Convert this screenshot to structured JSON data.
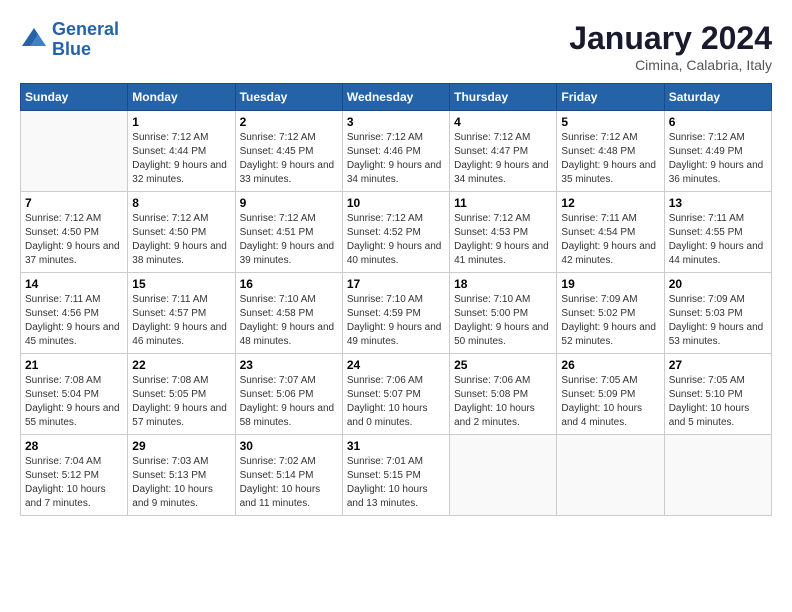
{
  "header": {
    "logo_line1": "General",
    "logo_line2": "Blue",
    "month": "January 2024",
    "location": "Cimina, Calabria, Italy"
  },
  "days_of_week": [
    "Sunday",
    "Monday",
    "Tuesday",
    "Wednesday",
    "Thursday",
    "Friday",
    "Saturday"
  ],
  "weeks": [
    [
      {
        "day": "",
        "sunrise": "",
        "sunset": "",
        "daylight": ""
      },
      {
        "day": "1",
        "sunrise": "Sunrise: 7:12 AM",
        "sunset": "Sunset: 4:44 PM",
        "daylight": "Daylight: 9 hours and 32 minutes."
      },
      {
        "day": "2",
        "sunrise": "Sunrise: 7:12 AM",
        "sunset": "Sunset: 4:45 PM",
        "daylight": "Daylight: 9 hours and 33 minutes."
      },
      {
        "day": "3",
        "sunrise": "Sunrise: 7:12 AM",
        "sunset": "Sunset: 4:46 PM",
        "daylight": "Daylight: 9 hours and 34 minutes."
      },
      {
        "day": "4",
        "sunrise": "Sunrise: 7:12 AM",
        "sunset": "Sunset: 4:47 PM",
        "daylight": "Daylight: 9 hours and 34 minutes."
      },
      {
        "day": "5",
        "sunrise": "Sunrise: 7:12 AM",
        "sunset": "Sunset: 4:48 PM",
        "daylight": "Daylight: 9 hours and 35 minutes."
      },
      {
        "day": "6",
        "sunrise": "Sunrise: 7:12 AM",
        "sunset": "Sunset: 4:49 PM",
        "daylight": "Daylight: 9 hours and 36 minutes."
      }
    ],
    [
      {
        "day": "7",
        "sunrise": "Sunrise: 7:12 AM",
        "sunset": "Sunset: 4:50 PM",
        "daylight": "Daylight: 9 hours and 37 minutes."
      },
      {
        "day": "8",
        "sunrise": "Sunrise: 7:12 AM",
        "sunset": "Sunset: 4:50 PM",
        "daylight": "Daylight: 9 hours and 38 minutes."
      },
      {
        "day": "9",
        "sunrise": "Sunrise: 7:12 AM",
        "sunset": "Sunset: 4:51 PM",
        "daylight": "Daylight: 9 hours and 39 minutes."
      },
      {
        "day": "10",
        "sunrise": "Sunrise: 7:12 AM",
        "sunset": "Sunset: 4:52 PM",
        "daylight": "Daylight: 9 hours and 40 minutes."
      },
      {
        "day": "11",
        "sunrise": "Sunrise: 7:12 AM",
        "sunset": "Sunset: 4:53 PM",
        "daylight": "Daylight: 9 hours and 41 minutes."
      },
      {
        "day": "12",
        "sunrise": "Sunrise: 7:11 AM",
        "sunset": "Sunset: 4:54 PM",
        "daylight": "Daylight: 9 hours and 42 minutes."
      },
      {
        "day": "13",
        "sunrise": "Sunrise: 7:11 AM",
        "sunset": "Sunset: 4:55 PM",
        "daylight": "Daylight: 9 hours and 44 minutes."
      }
    ],
    [
      {
        "day": "14",
        "sunrise": "Sunrise: 7:11 AM",
        "sunset": "Sunset: 4:56 PM",
        "daylight": "Daylight: 9 hours and 45 minutes."
      },
      {
        "day": "15",
        "sunrise": "Sunrise: 7:11 AM",
        "sunset": "Sunset: 4:57 PM",
        "daylight": "Daylight: 9 hours and 46 minutes."
      },
      {
        "day": "16",
        "sunrise": "Sunrise: 7:10 AM",
        "sunset": "Sunset: 4:58 PM",
        "daylight": "Daylight: 9 hours and 48 minutes."
      },
      {
        "day": "17",
        "sunrise": "Sunrise: 7:10 AM",
        "sunset": "Sunset: 4:59 PM",
        "daylight": "Daylight: 9 hours and 49 minutes."
      },
      {
        "day": "18",
        "sunrise": "Sunrise: 7:10 AM",
        "sunset": "Sunset: 5:00 PM",
        "daylight": "Daylight: 9 hours and 50 minutes."
      },
      {
        "day": "19",
        "sunrise": "Sunrise: 7:09 AM",
        "sunset": "Sunset: 5:02 PM",
        "daylight": "Daylight: 9 hours and 52 minutes."
      },
      {
        "day": "20",
        "sunrise": "Sunrise: 7:09 AM",
        "sunset": "Sunset: 5:03 PM",
        "daylight": "Daylight: 9 hours and 53 minutes."
      }
    ],
    [
      {
        "day": "21",
        "sunrise": "Sunrise: 7:08 AM",
        "sunset": "Sunset: 5:04 PM",
        "daylight": "Daylight: 9 hours and 55 minutes."
      },
      {
        "day": "22",
        "sunrise": "Sunrise: 7:08 AM",
        "sunset": "Sunset: 5:05 PM",
        "daylight": "Daylight: 9 hours and 57 minutes."
      },
      {
        "day": "23",
        "sunrise": "Sunrise: 7:07 AM",
        "sunset": "Sunset: 5:06 PM",
        "daylight": "Daylight: 9 hours and 58 minutes."
      },
      {
        "day": "24",
        "sunrise": "Sunrise: 7:06 AM",
        "sunset": "Sunset: 5:07 PM",
        "daylight": "Daylight: 10 hours and 0 minutes."
      },
      {
        "day": "25",
        "sunrise": "Sunrise: 7:06 AM",
        "sunset": "Sunset: 5:08 PM",
        "daylight": "Daylight: 10 hours and 2 minutes."
      },
      {
        "day": "26",
        "sunrise": "Sunrise: 7:05 AM",
        "sunset": "Sunset: 5:09 PM",
        "daylight": "Daylight: 10 hours and 4 minutes."
      },
      {
        "day": "27",
        "sunrise": "Sunrise: 7:05 AM",
        "sunset": "Sunset: 5:10 PM",
        "daylight": "Daylight: 10 hours and 5 minutes."
      }
    ],
    [
      {
        "day": "28",
        "sunrise": "Sunrise: 7:04 AM",
        "sunset": "Sunset: 5:12 PM",
        "daylight": "Daylight: 10 hours and 7 minutes."
      },
      {
        "day": "29",
        "sunrise": "Sunrise: 7:03 AM",
        "sunset": "Sunset: 5:13 PM",
        "daylight": "Daylight: 10 hours and 9 minutes."
      },
      {
        "day": "30",
        "sunrise": "Sunrise: 7:02 AM",
        "sunset": "Sunset: 5:14 PM",
        "daylight": "Daylight: 10 hours and 11 minutes."
      },
      {
        "day": "31",
        "sunrise": "Sunrise: 7:01 AM",
        "sunset": "Sunset: 5:15 PM",
        "daylight": "Daylight: 10 hours and 13 minutes."
      },
      {
        "day": "",
        "sunrise": "",
        "sunset": "",
        "daylight": ""
      },
      {
        "day": "",
        "sunrise": "",
        "sunset": "",
        "daylight": ""
      },
      {
        "day": "",
        "sunrise": "",
        "sunset": "",
        "daylight": ""
      }
    ]
  ]
}
